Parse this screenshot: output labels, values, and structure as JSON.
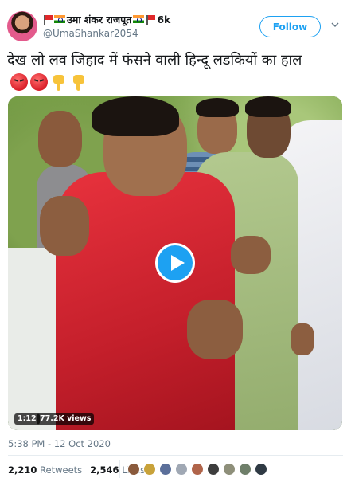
{
  "header": {
    "display_name": "उमा शंकर राजपूत",
    "followers_badge": "6k",
    "handle": "@UmaShankar2054",
    "follow_label": "Follow"
  },
  "tweet": {
    "text": "देख लो लव जिहाद में फंसने वाली हिन्दू लडकियों का हाल",
    "emojis": [
      "angry-face",
      "angry-face",
      "point-down",
      "point-down"
    ]
  },
  "video": {
    "duration": "1:12",
    "views": "77.2K views"
  },
  "meta": {
    "timestamp": "5:38 PM - 12 Oct 2020"
  },
  "stats": {
    "retweets_count": "2,210",
    "retweets_label": "Retweets",
    "likes_count": "2,546",
    "likes_label": "Likes"
  },
  "colors": {
    "accent": "#1da1f2",
    "text": "#14171a",
    "muted": "#657786",
    "liker_avatars": [
      "#8a5a3c",
      "#c8a23a",
      "#5b6f9a",
      "#a0a8b4",
      "#b0644a",
      "#3d3d3d",
      "#8e8f7a",
      "#6f7f6a",
      "#2f3a44"
    ]
  }
}
